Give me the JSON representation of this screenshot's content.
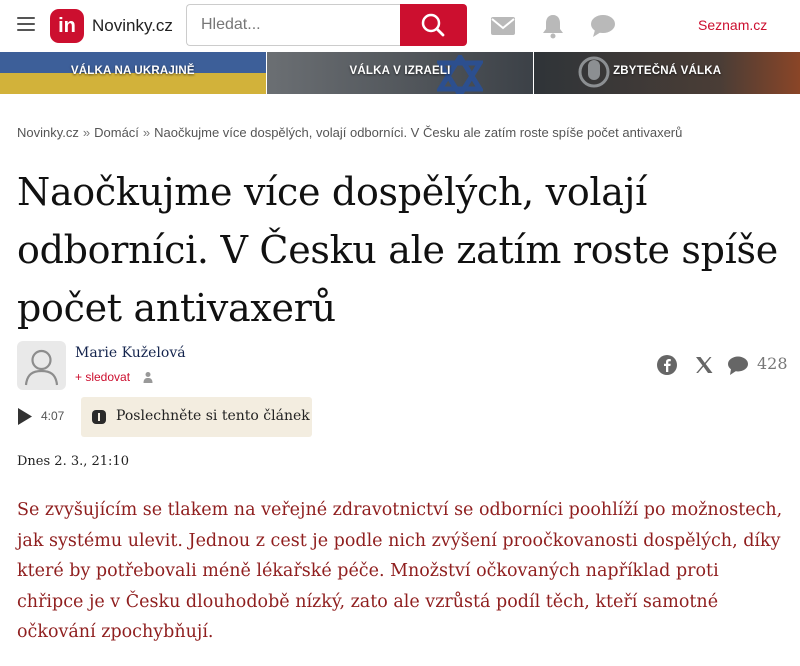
{
  "header": {
    "logo_badge": "in",
    "logo_text": "Novinky.cz",
    "search_placeholder": "Hledat...",
    "seznam_label": "Seznam.cz",
    "brand_color": "#cc0f2f"
  },
  "topics": [
    {
      "label": "VÁLKA NA UKRAJINĚ"
    },
    {
      "label": "VÁLKA V IZRAELI"
    },
    {
      "label": "ZBYTEČNÁ VÁLKA"
    }
  ],
  "breadcrumb": {
    "home": "Novinky.cz",
    "section": "Domácí",
    "current": "Naočkujme více dospělých, volají odborníci. V Česku ale zatím roste spíše počet antivaxerů",
    "separator": "»"
  },
  "article": {
    "title": "Naočkujme více dospělých, volají odborníci. V Česku ale zatím roste spíše počet antivaxerů",
    "author": "Marie Kuželová",
    "follow_label": "+ sledovat",
    "comment_count": "428",
    "audio_duration": "4:07",
    "listen_label": "Poslechněte si tento článek",
    "date": "Dnes 2. 3., 21:10",
    "perex": "Se zvyšujícím se tlakem na veřejné zdravotnictví se odborníci poohlíží po možnostech, jak systému ulevit. Jednou z cest je podle nich zvýšení proočkovanosti dospělých, díky které by potřebovali méně lékařské péče. Množství očkovaných například proti chřipce je v Česku dlouhodobě nízký, zato ale vzrůstá podíl těch, kteří samotné očkování zpochybňují.",
    "perex_color": "#8f1e1e"
  },
  "icons": {
    "menu": "hamburger-menu-icon",
    "search": "search-icon",
    "mail": "mail-icon",
    "bell": "bell-icon",
    "chat": "chat-icon",
    "facebook": "facebook-icon",
    "x": "x-icon",
    "comments": "comment-icon",
    "play": "play-icon"
  }
}
